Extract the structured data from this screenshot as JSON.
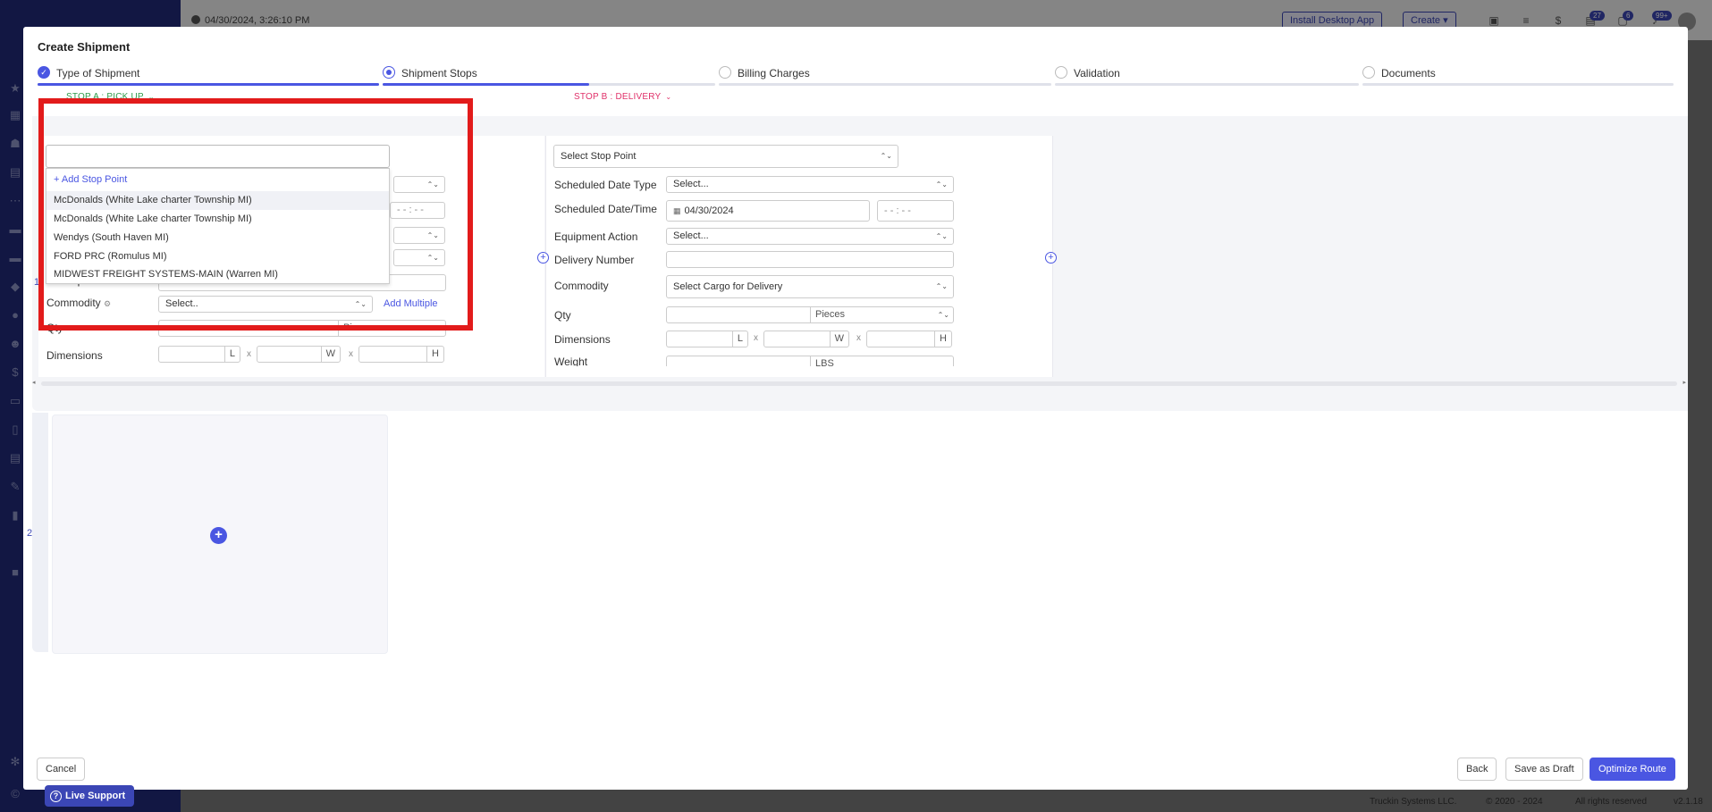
{
  "background": {
    "timestamp": "04/30/2024, 3:26:10 PM",
    "install_button": "Install Desktop App",
    "create_button": "Create",
    "badges": [
      "27",
      "6",
      "99+"
    ],
    "footer": {
      "company": "Truckin Systems LLC.",
      "copyright": "© 2020 - 2024",
      "rights": "All rights reserved",
      "version": "v2.1.18"
    },
    "live_support": "Live Support"
  },
  "modal": {
    "title": "Create Shipment",
    "steps": [
      {
        "label": "Type of Shipment",
        "state": "done",
        "progress": 1.0
      },
      {
        "label": "Shipment Stops",
        "state": "active",
        "progress": 0.62
      },
      {
        "label": "Billing Charges",
        "state": "pending",
        "progress": 0
      },
      {
        "label": "Validation",
        "state": "pending",
        "progress": 0
      },
      {
        "label": "Documents",
        "state": "pending",
        "progress": 0
      }
    ],
    "group_numbers": [
      "1",
      "2"
    ],
    "stop_a": {
      "header": "STOP A : PICK UP",
      "pick_up_number_label": "Pick Up Number",
      "commodity_label": "Commodity",
      "commodity_value": "Select..",
      "add_multiple": "Add Multiple",
      "qty_label": "Qty",
      "qty_unit": "Pieces",
      "dimensions_label": "Dimensions",
      "dim_units": [
        "L",
        "W",
        "H"
      ],
      "dim_sep": "x",
      "time_placeholder": "- -   :   - -"
    },
    "stop_b": {
      "header": "STOP B : DELIVERY",
      "stop_point_placeholder": "Select Stop Point",
      "scheduled_date_type_label": "Scheduled Date Type",
      "scheduled_date_type_value": "Select...",
      "scheduled_datetime_label": "Scheduled Date/Time",
      "date_value": "04/30/2024",
      "time_placeholder": "- -   :   - -",
      "equipment_action_label": "Equipment Action",
      "equipment_action_value": "Select...",
      "delivery_number_label": "Delivery Number",
      "commodity_label": "Commodity",
      "commodity_value": "Select Cargo for Delivery",
      "qty_label": "Qty",
      "qty_unit": "Pieces",
      "dimensions_label": "Dimensions",
      "dim_units": [
        "L",
        "W",
        "H"
      ],
      "dim_sep": "x",
      "weight_label": "Weight",
      "weight_unit": "LBS"
    },
    "dropdown": {
      "search_value": "",
      "add_label": "+ Add Stop Point",
      "options": [
        "McDonalds (White Lake charter Township MI)",
        "McDonalds (White Lake charter Township MI)",
        "Wendys (South Haven MI)",
        "FORD PRC (Romulus MI)",
        "MIDWEST FREIGHT SYSTEMS-MAIN (Warren MI)"
      ]
    },
    "footer": {
      "cancel": "Cancel",
      "back": "Back",
      "save_draft": "Save as Draft",
      "optimize": "Optimize Route"
    }
  },
  "colors": {
    "accent": "#4a56e2",
    "pickup": "#2e9b4a",
    "delivery": "#e0316a",
    "highlight": "#e21b1b"
  }
}
